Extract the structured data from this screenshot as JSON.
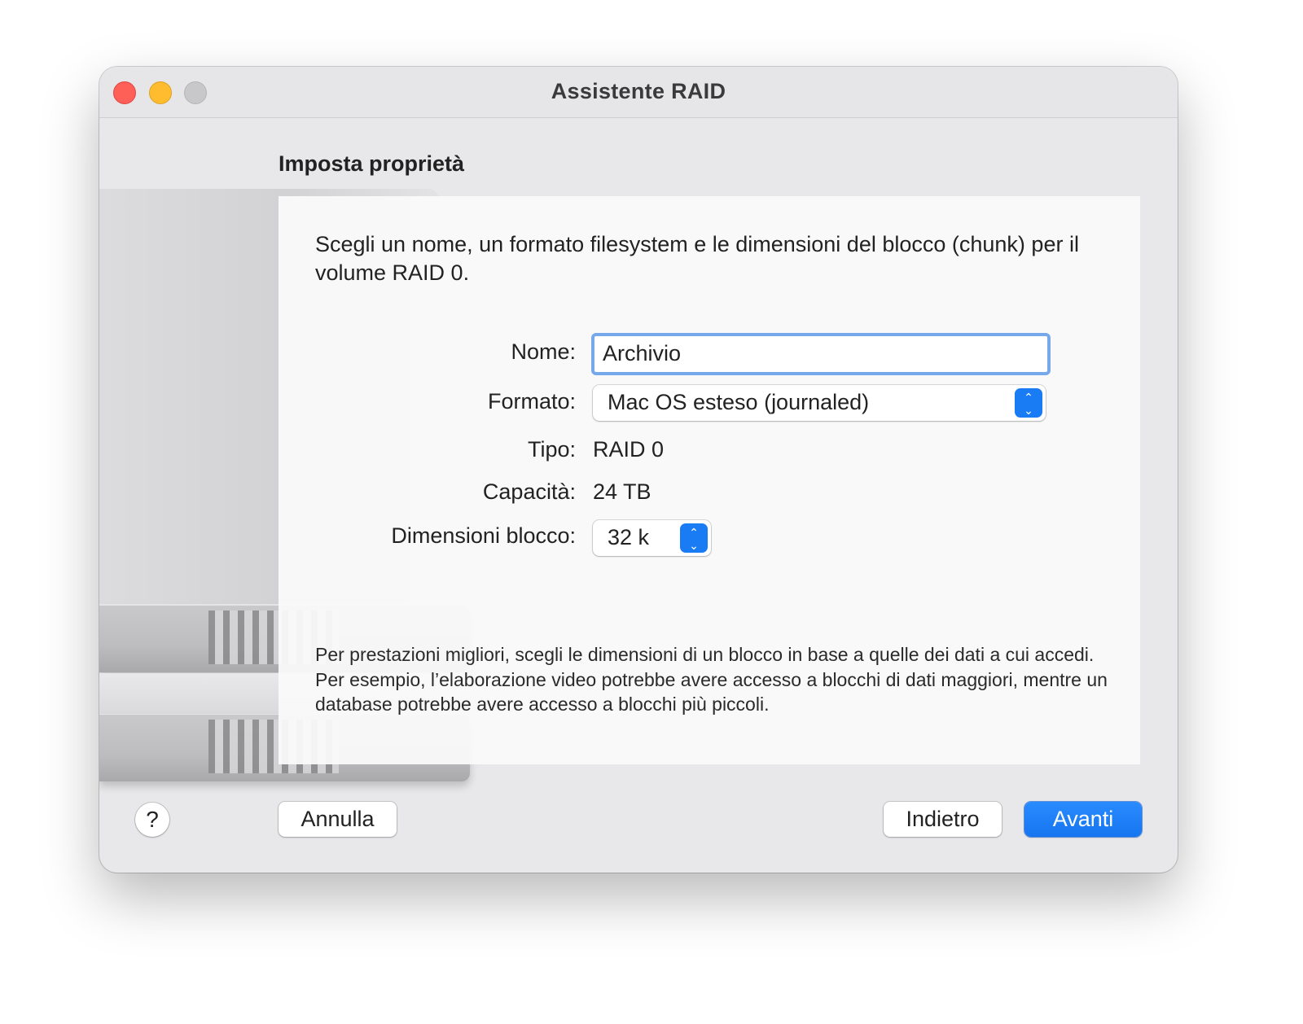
{
  "window": {
    "title": "Assistente RAID"
  },
  "section": {
    "title": "Imposta proprietà"
  },
  "intro": {
    "text": "Scegli un nome, un formato filesystem e le dimensioni del blocco (chunk) per il volume RAID 0."
  },
  "form": {
    "name_label": "Nome:",
    "name_value": "Archivio",
    "format_label": "Formato:",
    "format_value": "Mac OS esteso (journaled)",
    "type_label": "Tipo:",
    "type_value": "RAID 0",
    "capacity_label": "Capacità:",
    "capacity_value": "24 TB",
    "chunk_label": "Dimensioni blocco:",
    "chunk_value": "32 k"
  },
  "note": {
    "text": "Per prestazioni migliori, scegli le dimensioni di un blocco in base a quelle dei dati a cui accedi. Per esempio, l’elaborazione video potrebbe avere accesso a blocchi di dati maggiori, mentre un database potrebbe avere accesso a blocchi più piccoli."
  },
  "footer": {
    "help_label": "?",
    "cancel_label": "Annulla",
    "back_label": "Indietro",
    "next_label": "Avanti"
  },
  "colors": {
    "accent": "#1a7cf5",
    "close": "#fe5f57",
    "minimize": "#febc2e",
    "zoom_disabled": "#c8c8ca"
  },
  "icons": {
    "close": "close-button",
    "minimize": "minimize-button",
    "zoom": "zoom-button",
    "stepper": "up-down-chevron-icon"
  }
}
